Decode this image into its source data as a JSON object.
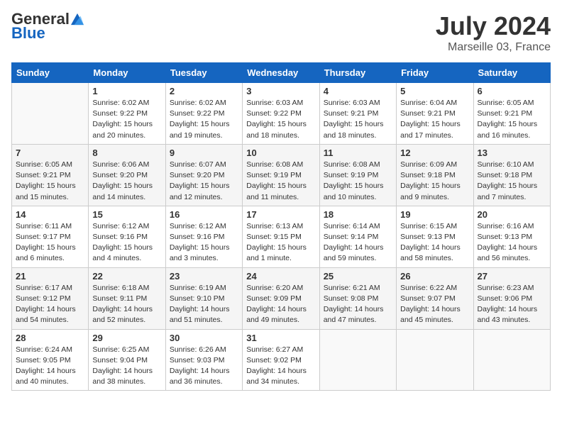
{
  "logo": {
    "general": "General",
    "blue": "Blue"
  },
  "month_title": "July 2024",
  "location": "Marseille 03, France",
  "days_header": [
    "Sunday",
    "Monday",
    "Tuesday",
    "Wednesday",
    "Thursday",
    "Friday",
    "Saturday"
  ],
  "weeks": [
    [
      {
        "day": "",
        "info": ""
      },
      {
        "day": "1",
        "info": "Sunrise: 6:02 AM\nSunset: 9:22 PM\nDaylight: 15 hours\nand 20 minutes."
      },
      {
        "day": "2",
        "info": "Sunrise: 6:02 AM\nSunset: 9:22 PM\nDaylight: 15 hours\nand 19 minutes."
      },
      {
        "day": "3",
        "info": "Sunrise: 6:03 AM\nSunset: 9:22 PM\nDaylight: 15 hours\nand 18 minutes."
      },
      {
        "day": "4",
        "info": "Sunrise: 6:03 AM\nSunset: 9:21 PM\nDaylight: 15 hours\nand 18 minutes."
      },
      {
        "day": "5",
        "info": "Sunrise: 6:04 AM\nSunset: 9:21 PM\nDaylight: 15 hours\nand 17 minutes."
      },
      {
        "day": "6",
        "info": "Sunrise: 6:05 AM\nSunset: 9:21 PM\nDaylight: 15 hours\nand 16 minutes."
      }
    ],
    [
      {
        "day": "7",
        "info": "Sunrise: 6:05 AM\nSunset: 9:21 PM\nDaylight: 15 hours\nand 15 minutes."
      },
      {
        "day": "8",
        "info": "Sunrise: 6:06 AM\nSunset: 9:20 PM\nDaylight: 15 hours\nand 14 minutes."
      },
      {
        "day": "9",
        "info": "Sunrise: 6:07 AM\nSunset: 9:20 PM\nDaylight: 15 hours\nand 12 minutes."
      },
      {
        "day": "10",
        "info": "Sunrise: 6:08 AM\nSunset: 9:19 PM\nDaylight: 15 hours\nand 11 minutes."
      },
      {
        "day": "11",
        "info": "Sunrise: 6:08 AM\nSunset: 9:19 PM\nDaylight: 15 hours\nand 10 minutes."
      },
      {
        "day": "12",
        "info": "Sunrise: 6:09 AM\nSunset: 9:18 PM\nDaylight: 15 hours\nand 9 minutes."
      },
      {
        "day": "13",
        "info": "Sunrise: 6:10 AM\nSunset: 9:18 PM\nDaylight: 15 hours\nand 7 minutes."
      }
    ],
    [
      {
        "day": "14",
        "info": "Sunrise: 6:11 AM\nSunset: 9:17 PM\nDaylight: 15 hours\nand 6 minutes."
      },
      {
        "day": "15",
        "info": "Sunrise: 6:12 AM\nSunset: 9:16 PM\nDaylight: 15 hours\nand 4 minutes."
      },
      {
        "day": "16",
        "info": "Sunrise: 6:12 AM\nSunset: 9:16 PM\nDaylight: 15 hours\nand 3 minutes."
      },
      {
        "day": "17",
        "info": "Sunrise: 6:13 AM\nSunset: 9:15 PM\nDaylight: 15 hours\nand 1 minute."
      },
      {
        "day": "18",
        "info": "Sunrise: 6:14 AM\nSunset: 9:14 PM\nDaylight: 14 hours\nand 59 minutes."
      },
      {
        "day": "19",
        "info": "Sunrise: 6:15 AM\nSunset: 9:13 PM\nDaylight: 14 hours\nand 58 minutes."
      },
      {
        "day": "20",
        "info": "Sunrise: 6:16 AM\nSunset: 9:13 PM\nDaylight: 14 hours\nand 56 minutes."
      }
    ],
    [
      {
        "day": "21",
        "info": "Sunrise: 6:17 AM\nSunset: 9:12 PM\nDaylight: 14 hours\nand 54 minutes."
      },
      {
        "day": "22",
        "info": "Sunrise: 6:18 AM\nSunset: 9:11 PM\nDaylight: 14 hours\nand 52 minutes."
      },
      {
        "day": "23",
        "info": "Sunrise: 6:19 AM\nSunset: 9:10 PM\nDaylight: 14 hours\nand 51 minutes."
      },
      {
        "day": "24",
        "info": "Sunrise: 6:20 AM\nSunset: 9:09 PM\nDaylight: 14 hours\nand 49 minutes."
      },
      {
        "day": "25",
        "info": "Sunrise: 6:21 AM\nSunset: 9:08 PM\nDaylight: 14 hours\nand 47 minutes."
      },
      {
        "day": "26",
        "info": "Sunrise: 6:22 AM\nSunset: 9:07 PM\nDaylight: 14 hours\nand 45 minutes."
      },
      {
        "day": "27",
        "info": "Sunrise: 6:23 AM\nSunset: 9:06 PM\nDaylight: 14 hours\nand 43 minutes."
      }
    ],
    [
      {
        "day": "28",
        "info": "Sunrise: 6:24 AM\nSunset: 9:05 PM\nDaylight: 14 hours\nand 40 minutes."
      },
      {
        "day": "29",
        "info": "Sunrise: 6:25 AM\nSunset: 9:04 PM\nDaylight: 14 hours\nand 38 minutes."
      },
      {
        "day": "30",
        "info": "Sunrise: 6:26 AM\nSunset: 9:03 PM\nDaylight: 14 hours\nand 36 minutes."
      },
      {
        "day": "31",
        "info": "Sunrise: 6:27 AM\nSunset: 9:02 PM\nDaylight: 14 hours\nand 34 minutes."
      },
      {
        "day": "",
        "info": ""
      },
      {
        "day": "",
        "info": ""
      },
      {
        "day": "",
        "info": ""
      }
    ]
  ]
}
